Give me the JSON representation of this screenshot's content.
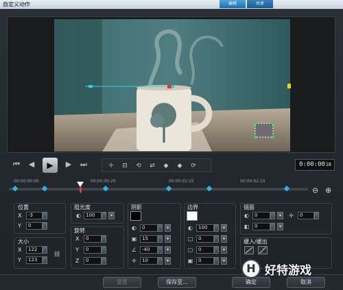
{
  "window": {
    "title": "自定义动作"
  },
  "top_tabs": [
    "编辑",
    "共享"
  ],
  "transport": {
    "timecode": "0:00:00",
    "frame": "18"
  },
  "timeline": {
    "labels": [
      "00:00:00:00",
      "00:00:00:20",
      "00:00:01:15",
      "00:00:02:10"
    ],
    "zoom_out": "⊖",
    "zoom_in": "⊕"
  },
  "position": {
    "title": "位置",
    "x_label": "X",
    "x_value": "-3",
    "y_label": "Y",
    "y_value": "0"
  },
  "size": {
    "title": "大小",
    "x_label": "X",
    "x_value": "122",
    "y_label": "Y",
    "y_value": "123"
  },
  "opacity": {
    "title": "阻光度",
    "value": "100"
  },
  "rotation": {
    "title": "旋转",
    "x_label": "X",
    "x_value": "0",
    "y_label": "Y",
    "y_value": "0",
    "z_label": "Z",
    "z_value": "0"
  },
  "shadow": {
    "title": "阴影",
    "color": "#000000",
    "opacity": "0",
    "blur": "15",
    "angle": "-40",
    "distance": "10"
  },
  "border": {
    "title": "边界",
    "color": "#ffffff",
    "opacity": "100",
    "v1": "0",
    "v2": "0",
    "v3": "0"
  },
  "mirror": {
    "title": "镜面",
    "opacity": "0",
    "distance": "0",
    "offset": "0"
  },
  "fade": {
    "title": "缓入/缓出"
  },
  "buttons": {
    "reset": "重置",
    "save_to": "保存至...",
    "ok": "确定",
    "cancel": "取消"
  },
  "watermark": {
    "logo": "H",
    "text": "好特游戏"
  },
  "colors": {
    "accent": "#2fb1e8",
    "window_bg": "#1e2328"
  }
}
